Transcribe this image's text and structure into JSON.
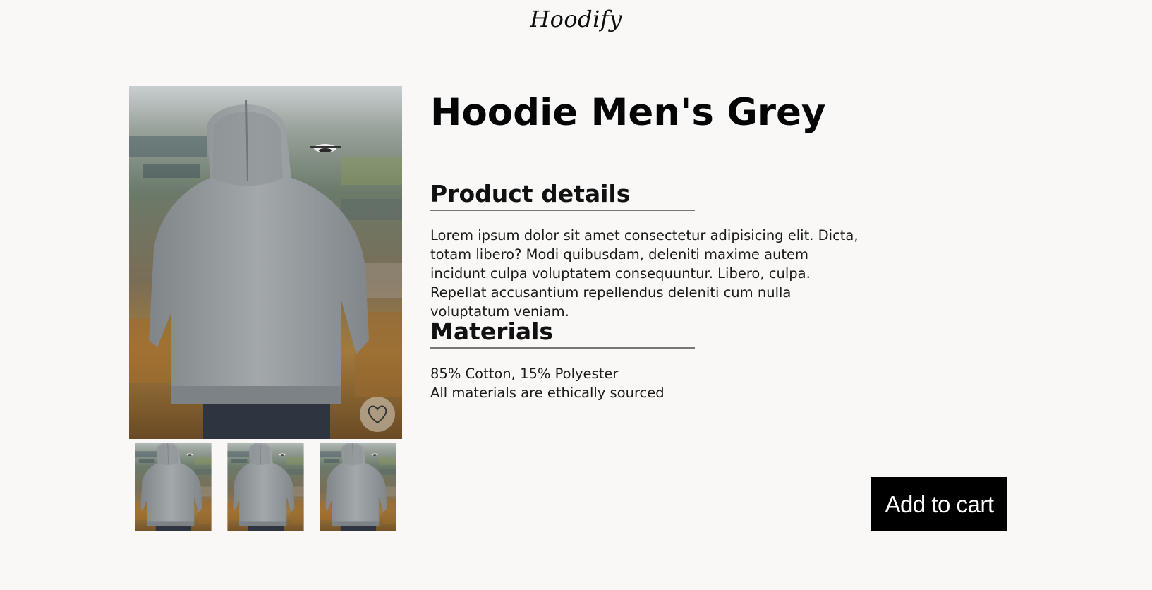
{
  "header": {
    "logo_text": "Hoodify"
  },
  "gallery": {
    "main_image_icon": "hoodie-photo",
    "favorite_icon": "heart-icon",
    "thumbnail_count": 3
  },
  "product": {
    "title": "Hoodie Men's Grey",
    "details_heading": "Product details",
    "details_text": "Lorem ipsum dolor sit amet consectetur adipisicing elit. Dicta, totam libero? Modi quibusdam, deleniti maxime autem incidunt culpa voluptatem consequuntur. Libero, culpa. Repellat accusantium repellendus deleniti cum nulla voluptatum veniam.",
    "materials_heading": "Materials",
    "materials_line1": "85% Cotton, 15% Polyester",
    "materials_line2": "All materials are ethically sourced"
  },
  "actions": {
    "add_to_cart_label": "Add to cart"
  },
  "colors": {
    "background": "#f9f8f6",
    "button_bg": "#000000",
    "button_text": "#ffffff",
    "heading_rule": "#777777"
  }
}
